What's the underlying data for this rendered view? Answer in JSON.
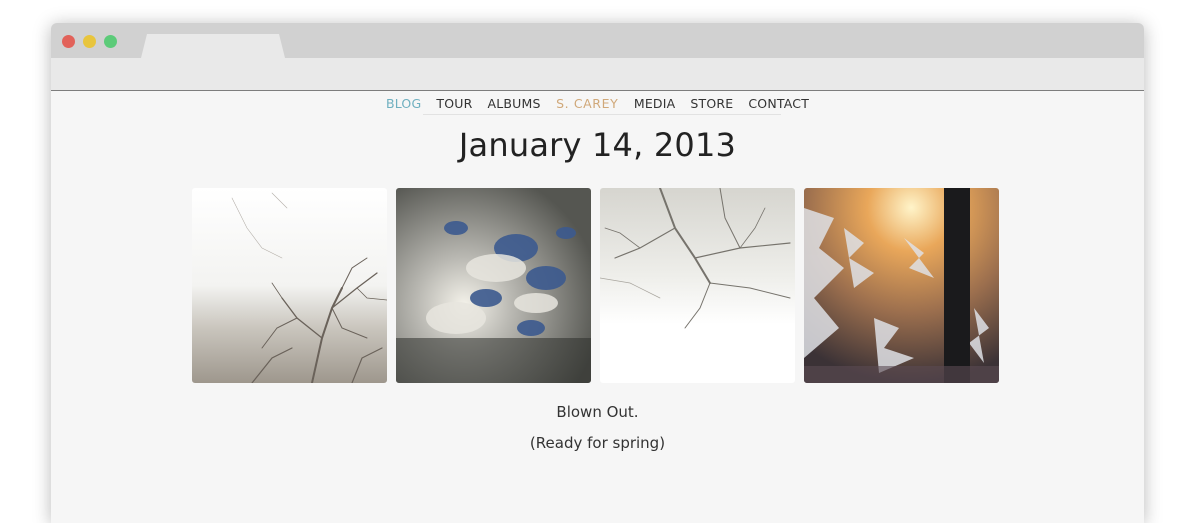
{
  "nav": {
    "items": [
      {
        "label": "BLOG",
        "active": true
      },
      {
        "label": "TOUR"
      },
      {
        "label": "ALBUMS"
      },
      {
        "label": "S. CAREY",
        "brand": true
      },
      {
        "label": "MEDIA"
      },
      {
        "label": "STORE"
      },
      {
        "label": "CONTACT"
      }
    ]
  },
  "post": {
    "date": "January 14, 2013",
    "caption_line1": "Blown Out.",
    "caption_line2": "(Ready for spring)"
  },
  "colors": {
    "active_nav": "#6fb0c0",
    "brand_nav": "#d0a879",
    "page_bg": "#f6f6f6"
  },
  "gallery": {
    "photos": [
      {
        "subject": "bare-tree-overexposed-sky"
      },
      {
        "subject": "clouds-blue-sky"
      },
      {
        "subject": "branches-foggy-sky"
      },
      {
        "subject": "frost-on-window-sunset"
      }
    ]
  }
}
